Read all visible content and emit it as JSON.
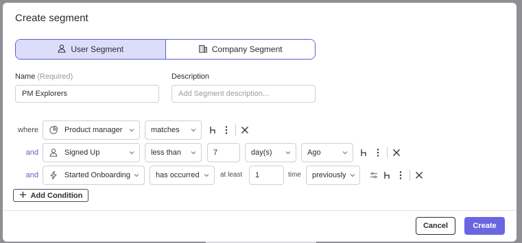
{
  "modal": {
    "title": "Create segment",
    "segment_types": [
      {
        "label": "User Segment",
        "icon": "user-icon",
        "active": true
      },
      {
        "label": "Company Segment",
        "icon": "building-icon",
        "active": false
      }
    ],
    "name": {
      "label": "Name",
      "hint": "(Required)",
      "value": "PM Explorers"
    },
    "description": {
      "label": "Description",
      "placeholder": "Add Segment description..."
    },
    "conditions": [
      {
        "conjunction": "where",
        "property": "Product manager",
        "property_icon": "pie-chart-icon",
        "operator": "matches"
      },
      {
        "conjunction": "and",
        "property": "Signed Up",
        "property_icon": "user-icon",
        "operator": "less than",
        "value": "7",
        "unit": "day(s)",
        "direction": "Ago"
      },
      {
        "conjunction": "and",
        "property": "Started Onboarding",
        "property_icon": "lightning-icon",
        "operator": "has occurred",
        "qualifier": "at least",
        "count": "1",
        "count_unit": "time",
        "timeframe": "previously"
      }
    ],
    "add_condition_label": "Add Condition",
    "cancel_label": "Cancel",
    "create_label": "Create",
    "accent_color": "#6a66e0"
  }
}
